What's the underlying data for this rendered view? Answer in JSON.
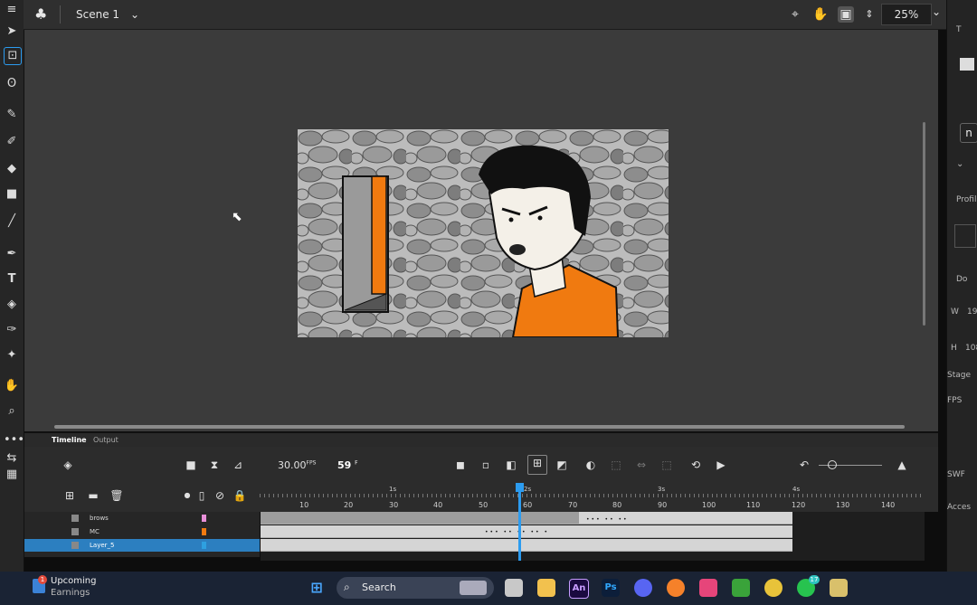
{
  "topbar": {
    "scene_label": "Scene 1",
    "zoom_value": "25%"
  },
  "timeline": {
    "tabs": [
      "Timeline",
      "Output"
    ],
    "fps_value": "30.00",
    "fps_unit": "FPS",
    "current_frame": "59",
    "frame_unit": "F",
    "ruler_numbers": [
      "10",
      "20",
      "30",
      "40",
      "50",
      "60",
      "70",
      "80",
      "90",
      "100",
      "110",
      "120",
      "130",
      "140"
    ],
    "second_markers": [
      "1s",
      "2s",
      "3s",
      "4s"
    ],
    "layers": [
      {
        "name": "brows",
        "color": "#e88fd8",
        "selected": false
      },
      {
        "name": "MC",
        "color": "#f07a10",
        "selected": false
      },
      {
        "name": "Layer_5",
        "color": "#2ea0e0",
        "selected": true
      }
    ]
  },
  "right_panel": {
    "labels": [
      "T",
      "Profil",
      "Do",
      "W",
      "19",
      "H",
      "108",
      "Stage",
      "FPS",
      "SWF",
      "Acces"
    ]
  },
  "taskbar": {
    "news_line1": "Upcoming",
    "news_line2": "Earnings",
    "news_badge": "1",
    "search_label": "Search",
    "app_labels": [
      "An",
      "Ps"
    ],
    "whatsapp_badge": "17"
  },
  "colors": {
    "accent": "#2c9cf0",
    "orange": "#f07a10"
  }
}
